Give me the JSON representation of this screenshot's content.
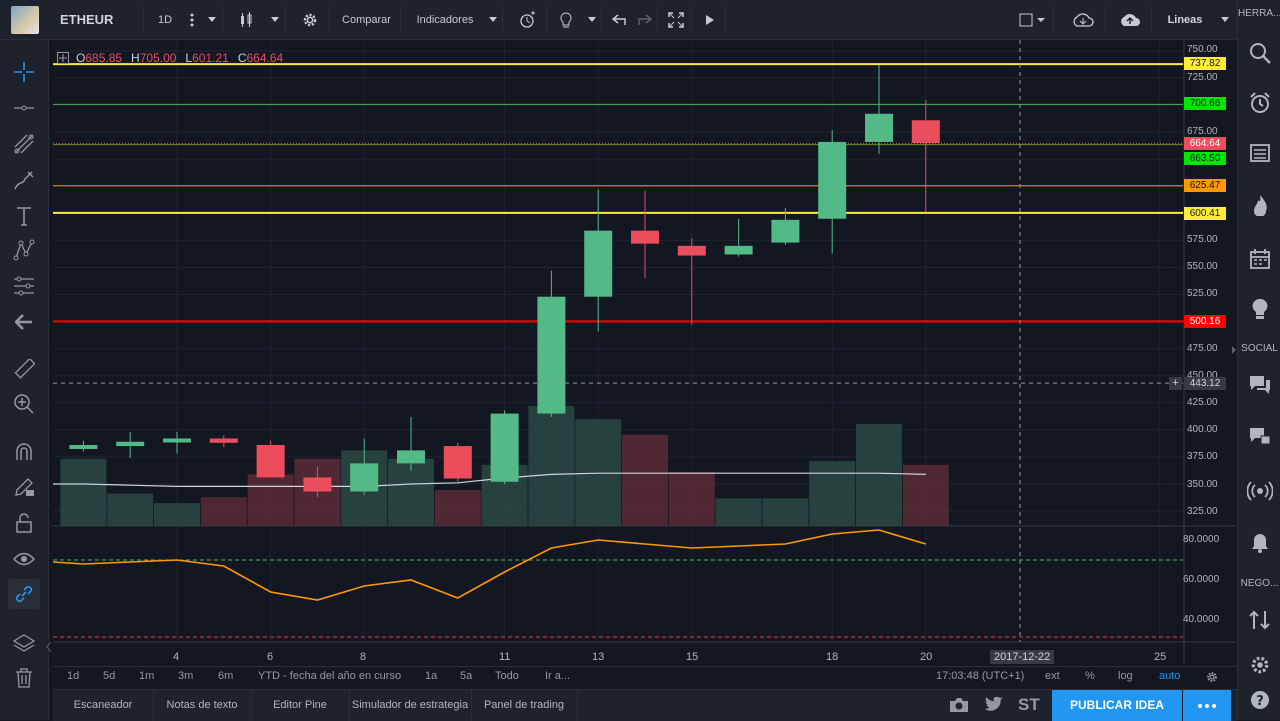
{
  "toolbar": {
    "symbol": "ETHEUR",
    "interval": "1D",
    "compare": "Comparar",
    "indicators": "Indicadores",
    "chart_type": "Lineas"
  },
  "ohlc": {
    "o_label": "O",
    "o": "685.85",
    "h_label": "H",
    "h": "705.00",
    "l_label": "L",
    "l": "601.21",
    "c_label": "C",
    "c": "664.64"
  },
  "price_labels": {
    "p750": "750.00",
    "p725": "725.00",
    "p675": "675.00",
    "p575": "575.00",
    "p550": "550.00",
    "p525": "525.00",
    "p475": "475.00",
    "p450": "450.00",
    "p425": "425.00",
    "p400": "400.00",
    "p375": "375.00",
    "p350": "350.00",
    "p325": "325.00"
  },
  "levels": {
    "l737": "737.82",
    "l700": "700.66",
    "l664": "664.64",
    "l663": "663.50",
    "l625": "625.47",
    "l600": "600.41",
    "l500": "500.16",
    "crosshair": "443.12"
  },
  "osc_labels": {
    "o80": "80.0000",
    "o60": "60.0000",
    "o40": "40.0000"
  },
  "x_labels": {
    "d4": "4",
    "d6": "6",
    "d8": "8",
    "d11": "11",
    "d13": "13",
    "d15": "15",
    "d18": "18",
    "d20": "20",
    "d25": "25",
    "cursor_date": "2017-12-22"
  },
  "ranges": {
    "r1d": "1d",
    "r5d": "5d",
    "r1m": "1m",
    "r3m": "3m",
    "r6m": "6m",
    "ytd": "YTD - fecha del año en curso",
    "r1a": "1a",
    "r5a": "5a",
    "todo": "Todo",
    "ira": "Ir a...",
    "time": "17:03:48 (UTC+1)",
    "ext": "ext",
    "pct": "%",
    "log": "log",
    "auto": "auto"
  },
  "bottom": {
    "scanner": "Escaneador",
    "notes": "Notas de texto",
    "pine": "Editor Pine",
    "strategy": "Simulador de estrategia",
    "trading": "Panel de trading",
    "publish": "PUBLICAR IDEA",
    "st": "ST"
  },
  "right": {
    "tools_label": "HERRA...",
    "social_label": "SOCIAL",
    "nego_label": "NEGO..."
  },
  "colors": {
    "up": "#53b987",
    "down": "#eb4d5c",
    "bg": "#131722",
    "yellow": "#ffeb3b",
    "green": "#4caf50",
    "orange": "#ff9800",
    "red": "#f00",
    "accent": "#2196f3"
  },
  "chart_data": {
    "type": "candlestick",
    "candles": [
      {
        "date": "2017-12-02",
        "o": 385,
        "h": 390,
        "l": 380,
        "c": 386
      },
      {
        "date": "2017-12-03",
        "o": 385,
        "h": 398,
        "l": 374,
        "c": 389
      },
      {
        "date": "2017-12-04",
        "o": 389,
        "h": 398,
        "l": 378,
        "c": 392
      },
      {
        "date": "2017-12-05",
        "o": 392,
        "h": 395,
        "l": 384,
        "c": 388
      },
      {
        "date": "2017-12-06",
        "o": 386,
        "h": 390,
        "l": 360,
        "c": 356
      },
      {
        "date": "2017-12-07",
        "o": 356,
        "h": 366,
        "l": 338,
        "c": 343
      },
      {
        "date": "2017-12-08",
        "o": 343,
        "h": 392,
        "l": 340,
        "c": 369
      },
      {
        "date": "2017-12-09",
        "o": 369,
        "h": 412,
        "l": 362,
        "c": 381
      },
      {
        "date": "2017-12-10",
        "o": 385,
        "h": 388,
        "l": 350,
        "c": 355
      },
      {
        "date": "2017-12-11",
        "o": 352,
        "h": 418,
        "l": 350,
        "c": 415
      },
      {
        "date": "2017-12-12",
        "o": 415,
        "h": 547,
        "l": 412,
        "c": 523
      },
      {
        "date": "2017-12-13",
        "o": 523,
        "h": 622,
        "l": 491,
        "c": 584
      },
      {
        "date": "2017-12-14",
        "o": 584,
        "h": 621,
        "l": 540,
        "c": 572
      },
      {
        "date": "2017-12-15",
        "o": 570,
        "h": 577,
        "l": 497,
        "c": 561
      },
      {
        "date": "2017-12-16",
        "o": 562,
        "h": 595,
        "l": 560,
        "c": 570
      },
      {
        "date": "2017-12-17",
        "o": 573,
        "h": 605,
        "l": 571,
        "c": 594
      },
      {
        "date": "2017-12-18",
        "o": 595,
        "h": 677,
        "l": 563,
        "c": 666
      },
      {
        "date": "2017-12-19",
        "o": 666,
        "h": 737,
        "l": 655,
        "c": 692
      },
      {
        "date": "2017-12-20",
        "o": 686,
        "h": 705,
        "l": 601,
        "c": 665
      }
    ],
    "volume_rel": [
      0.56,
      0.27,
      0.19,
      0.24,
      0.43,
      0.56,
      0.63,
      0.56,
      0.3,
      0.51,
      1.0,
      0.89,
      0.76,
      0.45,
      0.23,
      0.23,
      0.54,
      0.85,
      0.51
    ],
    "volume_ma": [
      0.45,
      0.44,
      0.43,
      0.43,
      0.43,
      0.43,
      0.43,
      0.45,
      0.46,
      0.5,
      0.53,
      0.54,
      0.54,
      0.54,
      0.54,
      0.54,
      0.54,
      0.54,
      0.53
    ],
    "oscillator": [
      69,
      68,
      69,
      70,
      67,
      54,
      50,
      57,
      60,
      51,
      64,
      76,
      80,
      78,
      76,
      77,
      78,
      83,
      85,
      78
    ],
    "oscillator_levels": [
      70,
      30
    ],
    "horizontal_levels": [
      737.82,
      700.66,
      663.5,
      625.47,
      600.41,
      500.16
    ],
    "y_range": [
      308,
      760
    ],
    "osc_range": [
      30,
      88
    ]
  }
}
